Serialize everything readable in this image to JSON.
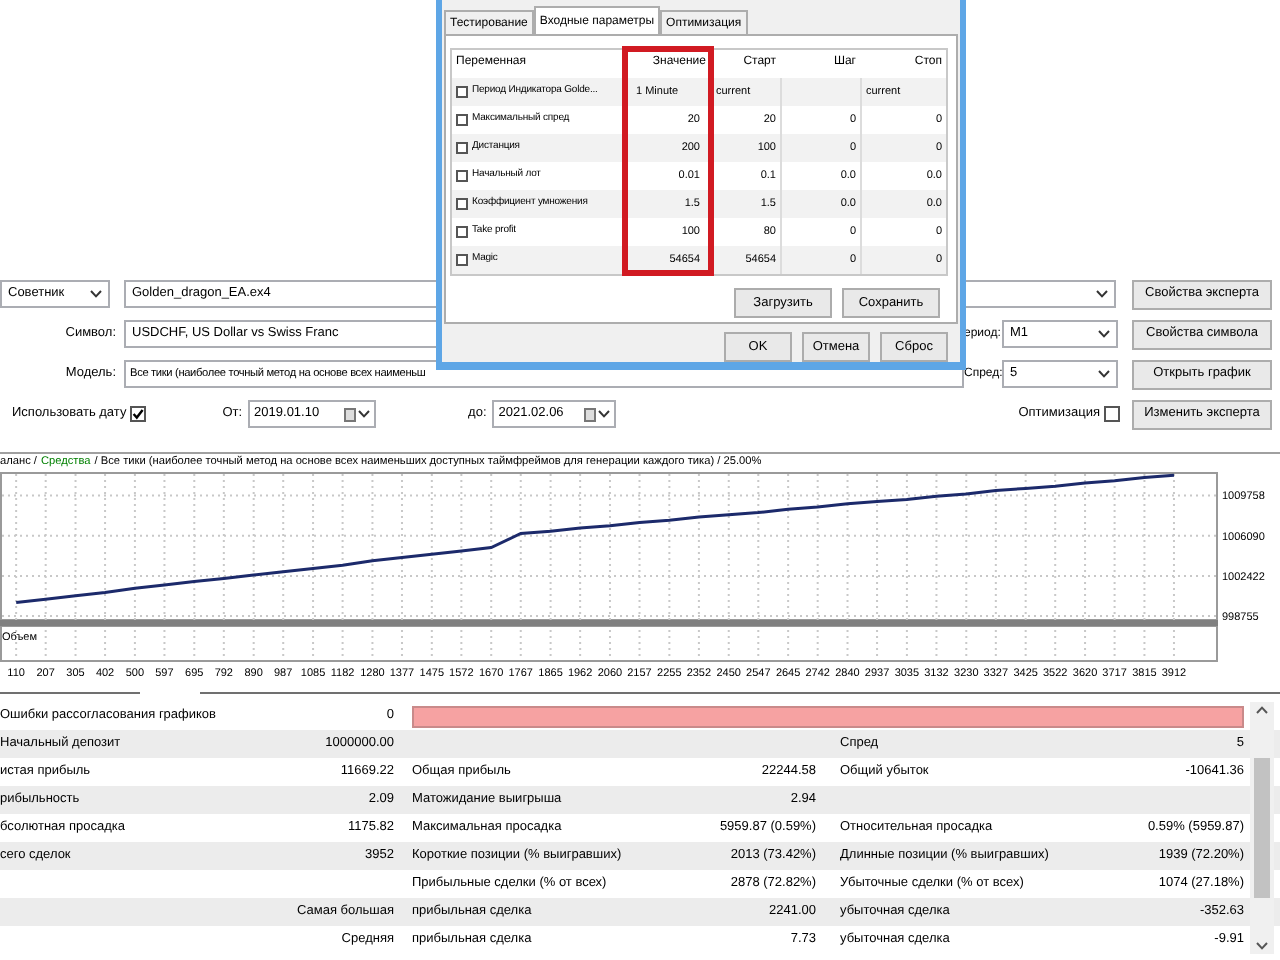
{
  "dialog": {
    "tabs": [
      {
        "label": "Тестирование",
        "selected": false
      },
      {
        "label": "Входные параметры",
        "selected": true
      },
      {
        "label": "Оптимизация",
        "selected": false
      }
    ],
    "columns": [
      "Переменная",
      "Значение",
      "Старт",
      "Шаг",
      "Стоп"
    ],
    "params": [
      {
        "name": "Период Индикатора Golde...",
        "checked": false,
        "value": "1 Minute",
        "start": "current",
        "stop": "current"
      },
      {
        "name": "Максимальный спред",
        "checked": false,
        "value": "20",
        "start": "20",
        "step": "0",
        "stop": "0"
      },
      {
        "name": "Дистанция",
        "checked": false,
        "value": "200",
        "start": "100",
        "step": "0",
        "stop": "0"
      },
      {
        "name": "Начальный лот",
        "checked": false,
        "value": "0.01",
        "start": "0.1",
        "step": "0.0",
        "stop": "0.0"
      },
      {
        "name": "Коэффициент умножения",
        "checked": false,
        "value": "1.5",
        "start": "1.5",
        "step": "0.0",
        "stop": "0.0"
      },
      {
        "name": "Take profit",
        "checked": false,
        "value": "100",
        "start": "80",
        "step": "0",
        "stop": "0"
      },
      {
        "name": "Magic",
        "checked": false,
        "value": "54654",
        "start": "54654",
        "step": "0",
        "stop": "0"
      }
    ],
    "panel_buttons": [
      "Загрузить",
      "Сохранить"
    ],
    "buttons": [
      "OK",
      "Отмена",
      "Сброс"
    ]
  },
  "expert": {
    "label": "Советник",
    "file": "Golden_dragon_EA.ex4"
  },
  "symbol": {
    "label": "Символ:",
    "value": "USDCHF, US Dollar vs Swiss Franc"
  },
  "model": {
    "label": "Модель:",
    "value": "Все тики (наиболее точный метод на основе всех наименьш"
  },
  "period": {
    "label": "ериод:",
    "value": "M1"
  },
  "spread": {
    "label": "Спред:",
    "value": "5"
  },
  "use_date": {
    "label": "Использовать дату",
    "checked": true
  },
  "from": {
    "label": "От:",
    "value": "2019.01.10"
  },
  "to": {
    "label": "до:",
    "value": "2021.02.06"
  },
  "optimization": {
    "label": "Оптимизация",
    "checked": false
  },
  "side_buttons": [
    "Свойства эксперта",
    "Свойства символа",
    "Открыть график",
    "Изменить эксперта"
  ],
  "chart": {
    "legend": [
      {
        "text": "аланс /",
        "color": "#000000"
      },
      {
        "text": "Средства",
        "color": "#008000"
      },
      {
        "text": "/ Все тики (наиболее точный метод на основе всех наименьших доступных таймфреймов для генерации каждого тика) / 25.00%",
        "color": "#000000"
      }
    ],
    "volume_label": "Объем",
    "chart_data": {
      "type": "line",
      "x": [
        110,
        207,
        305,
        402,
        500,
        597,
        695,
        792,
        890,
        987,
        1085,
        1182,
        1280,
        1377,
        1475,
        1572,
        1670,
        1767,
        1865,
        1962,
        2060,
        2157,
        2255,
        2352,
        2450,
        2547,
        2645,
        2742,
        2840,
        2937,
        3035,
        3132,
        3230,
        3327,
        3425,
        3522,
        3620,
        3717,
        3815,
        3912
      ],
      "series": [
        {
          "color": "#1c2a6b",
          "values": [
            1000000,
            1000300,
            1000600,
            1000900,
            1001300,
            1001600,
            1001900,
            1002200,
            1002500,
            1002800,
            1003100,
            1003400,
            1003800,
            1004100,
            1004400,
            1004700,
            1005000,
            1006300,
            1006500,
            1006800,
            1007000,
            1007300,
            1007500,
            1007800,
            1008000,
            1008200,
            1008500,
            1008700,
            1009000,
            1009200,
            1009400,
            1009700,
            1009900,
            1010200,
            1010400,
            1010600,
            1010900,
            1011100,
            1011400,
            1011600
          ]
        }
      ],
      "xlim": [
        57,
        4050
      ],
      "ylim": [
        998400,
        1011900
      ],
      "grid": true,
      "xticks": [
        110,
        207,
        305,
        402,
        500,
        597,
        695,
        792,
        890,
        987,
        1085,
        1182,
        1280,
        1377,
        1475,
        1572,
        1670,
        1767,
        1865,
        1962,
        2060,
        2157,
        2255,
        2352,
        2450,
        2547,
        2645,
        2742,
        2840,
        2937,
        3035,
        3132,
        3230,
        3327,
        3425,
        3522,
        3620,
        3717,
        3815,
        3912
      ],
      "yticks": [
        998755,
        1002422,
        1006090,
        1009758
      ]
    }
  },
  "report": {
    "rows": [
      {
        "kind": "bar",
        "column_1": "Ошибки рассогласования графиков",
        "column_2": "0",
        "level": 1
      },
      {
        "kind": "plain",
        "column_1": "Начальный депозит",
        "column_2": "1000000.00",
        "column_5": "Спред",
        "column_6": "5"
      },
      {
        "kind": "plain",
        "column_1": "истая прибыль",
        "column_2": "11669.22",
        "column_3": "Общая прибыль",
        "column_4": "22244.58",
        "column_5": "Общий убыток",
        "column_6": "-10641.36"
      },
      {
        "kind": "plain",
        "column_1": "рибыльность",
        "column_2": "2.09",
        "column_3": "Матожидание выигрыша",
        "column_4": "2.94"
      },
      {
        "kind": "plain",
        "column_1": "бсолютная просадка",
        "column_2": "1175.82",
        "column_3": "Максимальная просадка",
        "column_4": "5959.87 (0.59%)",
        "column_5": "Относительная просадка",
        "column_6": "0.59% (5959.87)"
      },
      {
        "kind": "plain",
        "column_1": "сего сделок",
        "column_2": "3952",
        "column_3": "Короткие позиции (% выигравших)",
        "column_4": "2013 (73.42%)",
        "column_5": "Длинные позиции (% выигравших)",
        "column_6": "1939 (72.20%)"
      },
      {
        "kind": "plain",
        "column_3": "Прибыльные сделки (% от всех)",
        "column_4": "2878 (72.82%)",
        "column_5": "Убыточные сделки (% от всех)",
        "column_6": "1074 (27.18%)"
      },
      {
        "kind": "plain",
        "column_2": "Самая большая",
        "column_3": "прибыльная сделка",
        "column_4": "2241.00",
        "column_5": "убыточная сделка",
        "column_6": "-352.63"
      },
      {
        "kind": "plain",
        "column_2": "Средняя",
        "column_3": "прибыльная сделка",
        "column_4": "7.73",
        "column_5": "убыточная сделка",
        "column_6": "-9.91"
      }
    ]
  }
}
